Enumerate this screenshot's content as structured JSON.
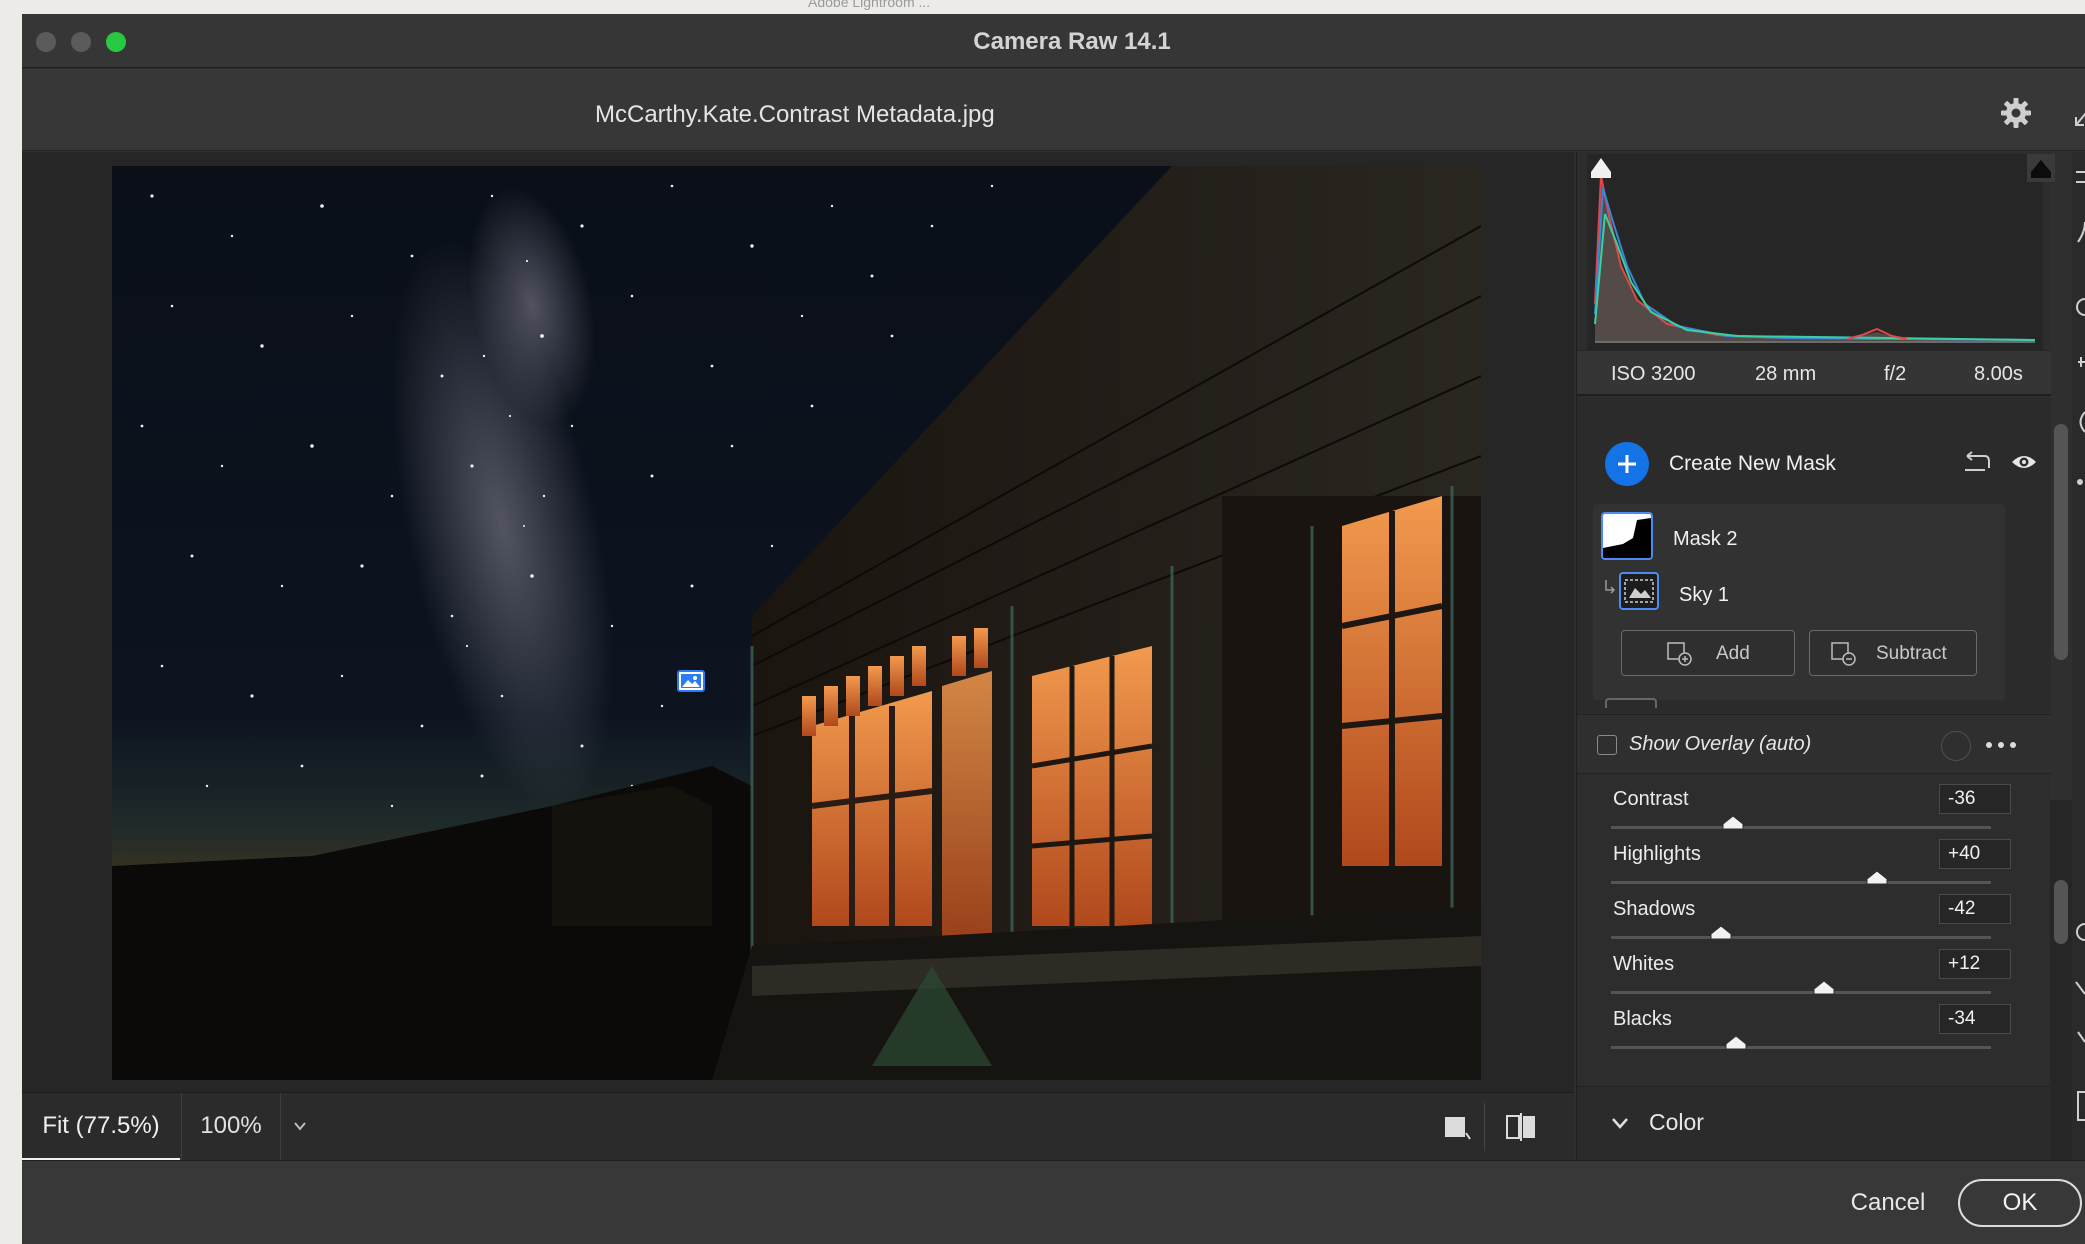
{
  "window": {
    "title": "Camera Raw 14.1",
    "file_name": "McCarthy.Kate.Contrast Metadata.jpg",
    "background_caption": "Adobe Lightroom ..."
  },
  "exif": {
    "iso": "ISO 3200",
    "focal_length": "28 mm",
    "aperture": "f/2",
    "shutter": "8.00s"
  },
  "masks": {
    "create_label": "Create New Mask",
    "items": [
      {
        "label": "Mask 2",
        "icon": "mask-thumbnail"
      },
      {
        "label": "Sky 1",
        "icon": "sky-mask-icon"
      }
    ],
    "add_label": "Add",
    "subtract_label": "Subtract",
    "overlay_label": "Show Overlay (auto)",
    "overlay_checked": false
  },
  "adjustments": [
    {
      "label": "Contrast",
      "value": "-36",
      "level": -36
    },
    {
      "label": "Highlights",
      "value": "+40",
      "level": 40
    },
    {
      "label": "Shadows",
      "value": "-42",
      "level": -42
    },
    {
      "label": "Whites",
      "value": "+12",
      "level": 12
    },
    {
      "label": "Blacks",
      "value": "-34",
      "level": -34
    }
  ],
  "color_section": {
    "label": "Color",
    "expanded": true
  },
  "zoom": {
    "fit_label": "Fit (77.5%)",
    "actual_label": "100%"
  },
  "footer": {
    "cancel_label": "Cancel",
    "ok_label": "OK"
  },
  "colors": {
    "accent": "#1473e6",
    "mask_border": "#4c8cf2",
    "window_bg": "#2f2f2f"
  }
}
